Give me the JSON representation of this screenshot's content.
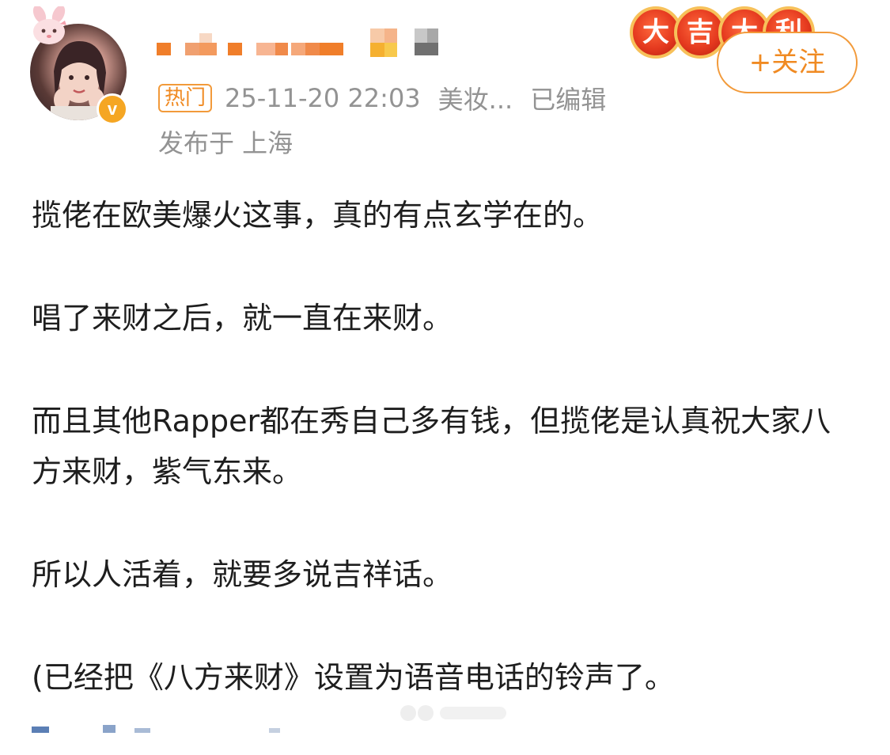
{
  "author": {
    "name": "",
    "verified_mark": "v",
    "follow_label": "+关注",
    "medals": [
      "大",
      "吉",
      "大",
      "利"
    ]
  },
  "meta": {
    "hot_label": "热门",
    "timestamp": "25-11-20 22:03",
    "category": "美妆...",
    "edited": "已编辑",
    "location": "发布于 上海"
  },
  "post": {
    "paragraphs": [
      "揽佬在欧美爆火这事，真的有点玄学在的。",
      "唱了来财之后，就一直在来财。",
      "而且其他Rapper都在秀自己多有钱，但揽佬是认真祝大家八方来财，紫气东来。",
      "所以人活着，就要多说吉祥话。",
      "(已经把《八方来财》设置为语音电话的铃声了。"
    ]
  },
  "colors": {
    "accent": "#f08a22",
    "meta_gray": "#939393",
    "text": "#1e1e1e",
    "medal_red": "#e53a1f"
  }
}
